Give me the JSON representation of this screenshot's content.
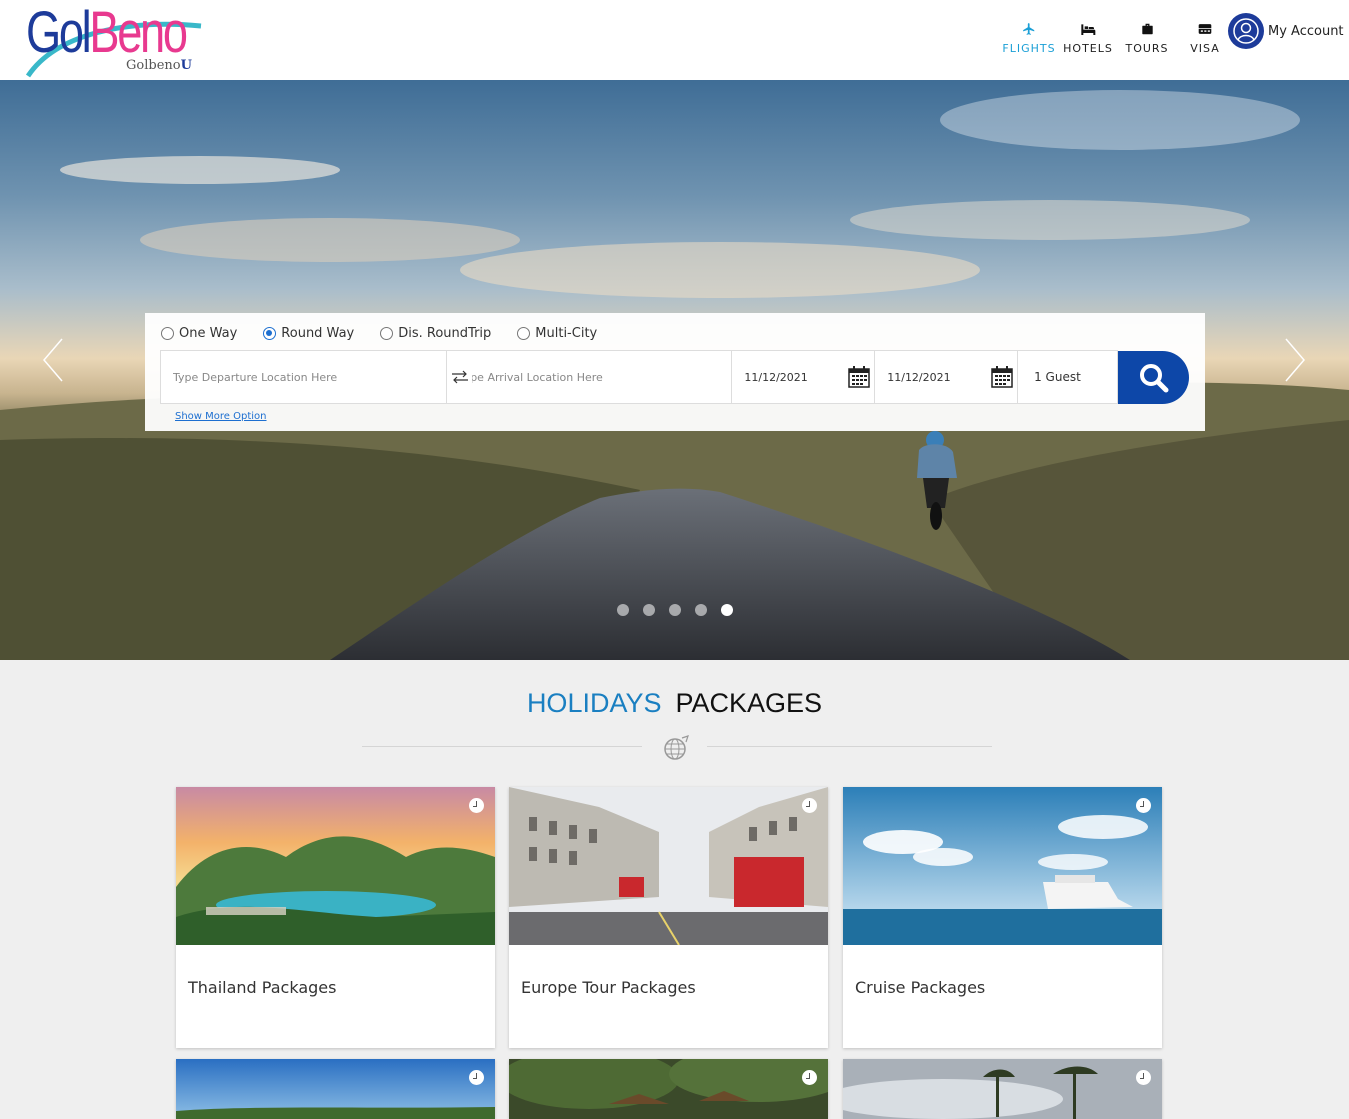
{
  "brand": {
    "logo_main_1": "Gol",
    "logo_main_2": "Beno",
    "logo_sub": "Golbeno",
    "logo_sub_accent": "U"
  },
  "nav": [
    {
      "label": "FLIGHTS",
      "icon": "plane-icon",
      "active": true
    },
    {
      "label": "HOTELS",
      "icon": "bed-icon",
      "active": false
    },
    {
      "label": "TOURS",
      "icon": "suitcase-icon",
      "active": false
    },
    {
      "label": "VISA",
      "icon": "visa-icon",
      "active": false
    }
  ],
  "account": {
    "label": "My Account",
    "icon": "user-icon"
  },
  "search": {
    "trip_types": [
      {
        "label": "One Way",
        "selected": false
      },
      {
        "label": "Round Way",
        "selected": true
      },
      {
        "label": "Dis. RoundTrip",
        "selected": false
      },
      {
        "label": "Multi-City",
        "selected": false
      }
    ],
    "departure_placeholder": "Type Departure Location Here",
    "arrival_placeholder": "Type Arrival Location Here",
    "depart_date": "11/12/2021",
    "return_date": "11/12/2021",
    "guests": "1 Guest",
    "more_option": "Show More Option"
  },
  "slider": {
    "slide_count": 5,
    "active_slide": 5
  },
  "section": {
    "title_part1": "HOLIDAYS",
    "title_part2": "PACKAGES"
  },
  "packages": [
    {
      "name": "Thailand Packages"
    },
    {
      "name": "Europe Tour Packages"
    },
    {
      "name": "Cruise Packages"
    },
    {
      "name": ""
    },
    {
      "name": ""
    },
    {
      "name": ""
    }
  ],
  "colors": {
    "accent": "#1a9fd6",
    "brand_blue": "#1d3b9a",
    "brand_pink": "#e8398f",
    "search_button": "#0d47a8",
    "section_blue": "#1a7fc1"
  }
}
